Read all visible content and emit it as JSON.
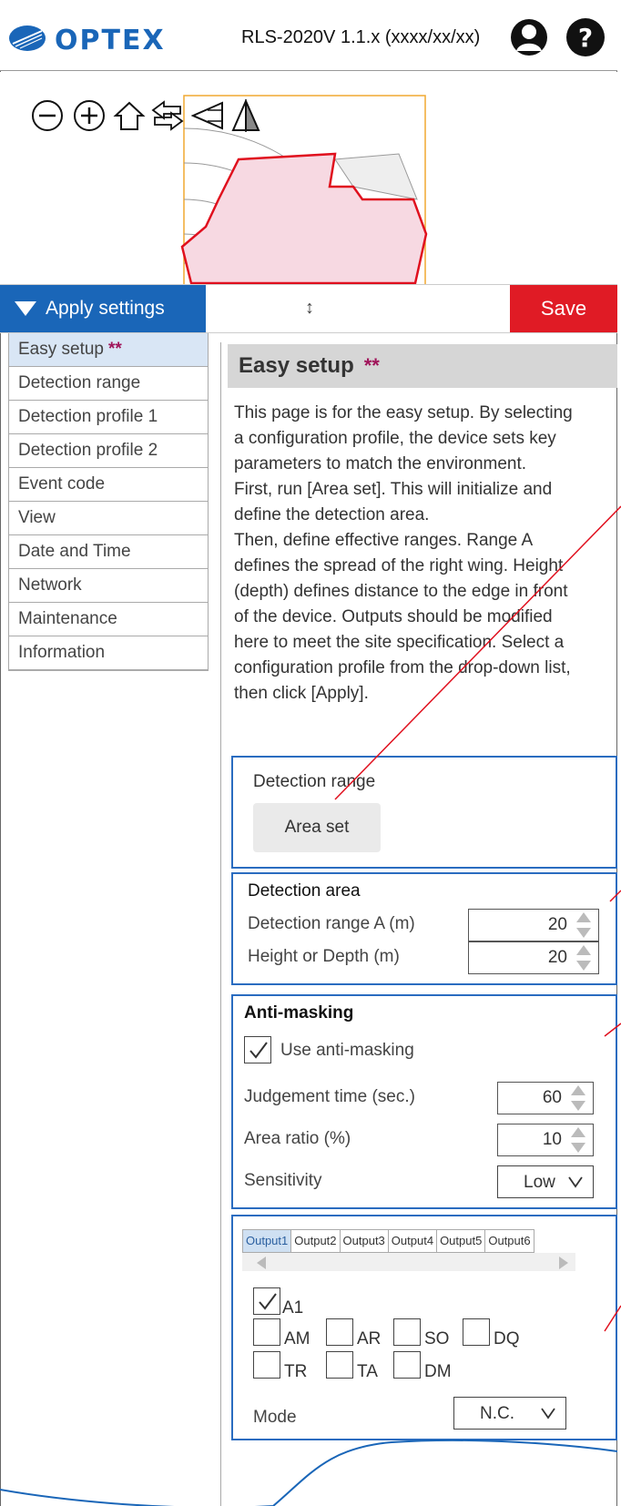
{
  "header": {
    "brand": "OPTEX",
    "version": "RLS-2020V 1.1.x (xxxx/xx/xx)",
    "user_icon": "user-icon",
    "help_icon": "help-icon"
  },
  "preview": {
    "tools": [
      "zoom-out-icon",
      "zoom-in-icon",
      "home-icon",
      "swap-arrows-icon",
      "flip-horizontal-icon",
      "mirror-icon"
    ]
  },
  "apply_bar": {
    "apply_label": "Apply settings",
    "resize_symbol": "↕",
    "save_label": "Save"
  },
  "sidebar": {
    "items": [
      {
        "label": "Easy setup",
        "badge": "**"
      },
      {
        "label": "Detection range"
      },
      {
        "label": "Detection profile 1"
      },
      {
        "label": "Detection profile 2"
      },
      {
        "label": "Event code"
      },
      {
        "label": "View"
      },
      {
        "label": "Date and Time"
      },
      {
        "label": "Network"
      },
      {
        "label": "Maintenance"
      },
      {
        "label": "Information"
      }
    ]
  },
  "main": {
    "title": "Easy setup",
    "title_badge": "**",
    "description": [
      "This page is for the easy setup. By selecting",
      "a configuration profile, the device sets key",
      "parameters to match the environment.",
      "First, run [Area set]. This will initialize and",
      "define the detection area.",
      "Then, define effective ranges. Range A",
      "defines the spread of the right wing. Height",
      "(depth) defines distance to the edge in front",
      "of the device. Outputs should be modified",
      "here to meet the site specification. Select a",
      "configuration profile from the drop-down list,",
      "then click [Apply]."
    ],
    "detection_range": {
      "label": "Detection range",
      "area_set_label": "Area set"
    },
    "detection_area": {
      "title": "Detection area",
      "range_a_label": "Detection range A (m)",
      "range_a_value": "20",
      "height_label": "Height or Depth (m)",
      "height_value": "20"
    },
    "anti_masking": {
      "title": "Anti-masking",
      "use_label": "Use anti-masking",
      "use_checked": true,
      "judgement_label": "Judgement time (sec.)",
      "judgement_value": "60",
      "ratio_label": "Area ratio (%)",
      "ratio_value": "10",
      "sensitivity_label": "Sensitivity",
      "sensitivity_value": "Low"
    },
    "outputs": {
      "tabs": [
        "Output1",
        "Output2",
        "Output3",
        "Output4",
        "Output5",
        "Output6"
      ],
      "active_tab": "Output1",
      "codes": [
        {
          "label": "A1",
          "checked": true
        },
        {
          "label": "AM",
          "checked": false
        },
        {
          "label": "AR",
          "checked": false
        },
        {
          "label": "SO",
          "checked": false
        },
        {
          "label": "DQ",
          "checked": false
        },
        {
          "label": "TR",
          "checked": false
        },
        {
          "label": "TA",
          "checked": false
        },
        {
          "label": "DM",
          "checked": false
        }
      ],
      "mode_label": "Mode",
      "mode_value": "N.C."
    }
  },
  "colors": {
    "accent_blue": "#1a66b8",
    "save_red": "#e01b25",
    "box_border": "#2a6cc0",
    "area_fill": "#f7d9e2",
    "area_stroke": "#e0101e",
    "frame_orange": "#f0a830",
    "badge_purple": "#a0145a"
  }
}
